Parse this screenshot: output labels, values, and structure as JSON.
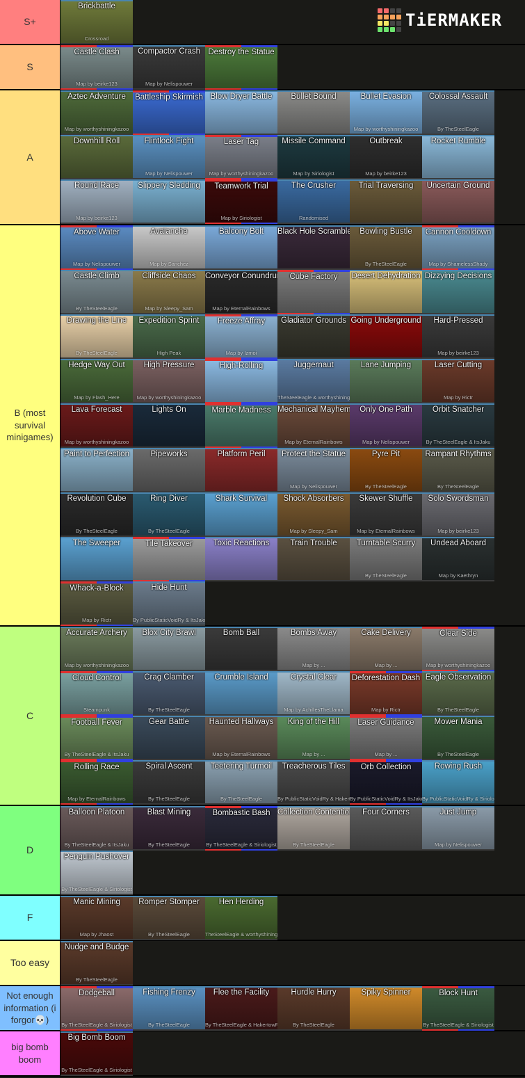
{
  "logo": {
    "text": "TiERMAKER",
    "grid_colors": [
      "#f46a6a",
      "#f46a6a",
      "#444",
      "#444",
      "#f7a35c",
      "#f7a35c",
      "#f7a35c",
      "#f7a35c",
      "#f5e663",
      "#f5e663",
      "#444",
      "#444",
      "#6de36d",
      "#6de36d",
      "#6de36d",
      "#444"
    ]
  },
  "tiers": [
    {
      "label": "S+",
      "color": "#ff7f7f",
      "items": [
        {
          "title": "Brickbattle",
          "sub": "Crossroad",
          "bg": "#6f7a3a"
        }
      ]
    },
    {
      "label": "S",
      "color": "#ffbf7f",
      "items": [
        {
          "title": "Castle Clash",
          "sub": "Map by beirke123",
          "bg": "#7a8a8a",
          "team": true
        },
        {
          "title": "Compactor Crash",
          "sub": "Map by Nelispouwer",
          "bg": "#3a3a3a"
        },
        {
          "title": "Destroy the Statue",
          "sub": "",
          "bg": "#4c7a3a",
          "team": true
        }
      ]
    },
    {
      "label": "A",
      "color": "#ffdf7f",
      "items": [
        {
          "title": "Aztec Adventure",
          "sub": "Map by worthyshiningkazoo",
          "bg": "#4e6a3a"
        },
        {
          "title": "Battleship Skirmish",
          "sub": "",
          "bg": "#3a6ad0",
          "team": true
        },
        {
          "title": "Blow Dryer Battle",
          "sub": "",
          "bg": "#8ab8e0"
        },
        {
          "title": "Bullet Bound",
          "sub": "",
          "bg": "#8a8a88"
        },
        {
          "title": "Bullet Evasion",
          "sub": "Map by worthyshiningkazoo",
          "bg": "#7ab0e0"
        },
        {
          "title": "Colossal Assault",
          "sub": "By TheSteelEagle",
          "bg": "#5a6e80"
        },
        {
          "title": "Downhill Roll",
          "sub": "",
          "bg": "#5a6a3a"
        },
        {
          "title": "Flintlock Fight",
          "sub": "Map by Nelispouwer",
          "bg": "#5a90c0"
        },
        {
          "title": "Laser Tag",
          "sub": "Map by worthyshiningkazoo",
          "bg": "#7a7e88",
          "team": true
        },
        {
          "title": "Missile Command",
          "sub": "Map by Siriologist",
          "bg": "#1e3a40"
        },
        {
          "title": "Outbreak",
          "sub": "Map by beirke123",
          "bg": "#2e2e2e"
        },
        {
          "title": "Rocket Rumble",
          "sub": "",
          "bg": "#8ab8d8"
        },
        {
          "title": "Round Race",
          "sub": "Map by beirke123",
          "bg": "#a0b0c0"
        },
        {
          "title": "Slippery Sledding",
          "sub": "",
          "bg": "#7ab0d0"
        },
        {
          "title": "Teamwork Trial",
          "sub": "Map by Siriologist",
          "bg": "#3a0a0a",
          "team": true
        },
        {
          "title": "The Crusher",
          "sub": "Randomised",
          "bg": "#3a6aa0"
        },
        {
          "title": "Trial Traversing",
          "sub": "",
          "bg": "#6a5a3a"
        },
        {
          "title": "Uncertain Ground",
          "sub": "",
          "bg": "#8a5a5a"
        }
      ]
    },
    {
      "label": "B (most survival minigames)",
      "color": "#ffff7f",
      "items": [
        {
          "title": "Above Water",
          "sub": "Map by Nelispouwer",
          "bg": "#5a8ac0",
          "team": true
        },
        {
          "title": "Avalanche",
          "sub": "Map by Sanchez",
          "bg": "#c8c8c8"
        },
        {
          "title": "Balcony Bolt",
          "sub": "",
          "bg": "#7aa8d8"
        },
        {
          "title": "Black Hole Scramble",
          "sub": "",
          "bg": "#3a2a3a"
        },
        {
          "title": "Bowling Bustle",
          "sub": "By TheSteelEagle",
          "bg": "#6a5a3a"
        },
        {
          "title": "Cannon Cooldown",
          "sub": "Map by ShamelessShady",
          "bg": "#7aa0c0",
          "team": true
        },
        {
          "title": "Castle Climb",
          "sub": "By TheSteelEagle",
          "bg": "#7a8a90"
        },
        {
          "title": "Cliffside Chaos",
          "sub": "Map by Sleepy_Sam",
          "bg": "#8a7a4a"
        },
        {
          "title": "Conveyor Conundrum",
          "sub": "Map by EternalRainbows",
          "bg": "#2a2a2a"
        },
        {
          "title": "Cube Factory",
          "sub": "",
          "bg": "#7a7a7a",
          "team": true
        },
        {
          "title": "Desert Dehydration",
          "sub": "",
          "bg": "#d8c07a"
        },
        {
          "title": "Dizzying Decisions",
          "sub": "",
          "bg": "#4a8a90"
        },
        {
          "title": "Drawing the Line",
          "sub": "By TheSteelEagle",
          "bg": "#e8d0a8"
        },
        {
          "title": "Expedition Sprint",
          "sub": "High Peak",
          "bg": "#4a6a4a"
        },
        {
          "title": "Freeze Affray",
          "sub": "Map by Izmoi",
          "bg": "#8ab0d0",
          "team": true
        },
        {
          "title": "Gladiator Grounds",
          "sub": "",
          "bg": "#3a3a30"
        },
        {
          "title": "Going Underground",
          "sub": "",
          "bg": "#8a0a0a"
        },
        {
          "title": "Hard-Pressed",
          "sub": "Map by beirke123",
          "bg": "#3a3a3a"
        },
        {
          "title": "Hedge Way Out",
          "sub": "Map by Flash_Here",
          "bg": "#4a6a3a"
        },
        {
          "title": "High Pressure",
          "sub": "Map by worthyshiningkazoo",
          "bg": "#7a6060"
        },
        {
          "title": "High-Rolling",
          "sub": "",
          "bg": "#8ab8e0",
          "team": true
        },
        {
          "title": "Juggernaut",
          "sub": "TheSteelEagle & worthyshiningkazoo",
          "bg": "#5a7aa0"
        },
        {
          "title": "Lane Jumping",
          "sub": "",
          "bg": "#5a7a5a"
        },
        {
          "title": "Laser Cutting",
          "sub": "Map by Rictr",
          "bg": "#6a3a2a"
        },
        {
          "title": "Lava Forecast",
          "sub": "Map by worthyshiningkazoo",
          "bg": "#6a1a1a"
        },
        {
          "title": "Lights On",
          "sub": "",
          "bg": "#1a2a3a"
        },
        {
          "title": "Marble Madness",
          "sub": "",
          "bg": "#4a7a6a",
          "team": true
        },
        {
          "title": "Mechanical Mayhem",
          "sub": "Map by EternalRainbows",
          "bg": "#6a4a3a"
        },
        {
          "title": "Only One Path",
          "sub": "Map by Nelispouwer",
          "bg": "#5a3a6a"
        },
        {
          "title": "Orbit Snatcher",
          "sub": "By TheSteelEagle & ItsJaku",
          "bg": "#2a3a40"
        },
        {
          "title": "Paint to Perfection",
          "sub": "",
          "bg": "#8ab0c8"
        },
        {
          "title": "Pipeworks",
          "sub": "",
          "bg": "#6a6a6a"
        },
        {
          "title": "Platform Peril",
          "sub": "",
          "bg": "#8a2a2a"
        },
        {
          "title": "Protect the Statue",
          "sub": "Map by Nelispouwer",
          "bg": "#7a8a9a"
        },
        {
          "title": "Pyre Pit",
          "sub": "By TheSteelEagle",
          "bg": "#8a4a10"
        },
        {
          "title": "Rampant Rhythms",
          "sub": "By TheSteelEagle",
          "bg": "#5a5a4a"
        },
        {
          "title": "Revolution Cube",
          "sub": "By TheSteelEagle",
          "bg": "#2a2a2a"
        },
        {
          "title": "Ring Diver",
          "sub": "By TheSteelEagle",
          "bg": "#2a5a70"
        },
        {
          "title": "Shark Survival",
          "sub": "",
          "bg": "#5aa0d0"
        },
        {
          "title": "Shock Absorbers",
          "sub": "Map by Sleepy_Sam",
          "bg": "#7a5a30"
        },
        {
          "title": "Skewer Shuffle",
          "sub": "Map by EternalRainbows",
          "bg": "#3a3a3a"
        },
        {
          "title": "Solo Swordsman",
          "sub": "Map by beirke123",
          "bg": "#6a6a70"
        },
        {
          "title": "The Sweeper",
          "sub": "",
          "bg": "#5aa0d0"
        },
        {
          "title": "Tile Takeover",
          "sub": "",
          "bg": "#9a9a9a",
          "team": true
        },
        {
          "title": "Toxic Reactions",
          "sub": "",
          "bg": "#8a80c8"
        },
        {
          "title": "Train Trouble",
          "sub": "",
          "bg": "#5a5040"
        },
        {
          "title": "Turntable Scurry",
          "sub": "By TheSteelEagle",
          "bg": "#7a7a7a"
        },
        {
          "title": "Undead Aboard",
          "sub": "Map by Kaethryn",
          "bg": "#2a3030"
        },
        {
          "title": "Whack-a-Block",
          "sub": "Map by Rictr",
          "bg": "#5a5a40",
          "team": true
        },
        {
          "title": "Hide Hunt",
          "sub": "By PublicStaticVoidRy & ItsJaku",
          "bg": "#6a7a8a"
        }
      ]
    },
    {
      "label": "C",
      "color": "#bfff7f",
      "items": [
        {
          "title": "Accurate Archery",
          "sub": "Map by worthyshiningkazoo",
          "bg": "#6a7a5a"
        },
        {
          "title": "Blox City Brawl",
          "sub": "",
          "bg": "#8a9aa0"
        },
        {
          "title": "Bomb Ball",
          "sub": "",
          "bg": "#3a3a3a"
        },
        {
          "title": "Bombs Away",
          "sub": "Map by ...",
          "bg": "#8a8a8a"
        },
        {
          "title": "Cake Delivery",
          "sub": "Map by ...",
          "bg": "#8a7a6a"
        },
        {
          "title": "Clear Side",
          "sub": "Map by worthyshiningkazoo",
          "bg": "#8a8a88",
          "team": true
        },
        {
          "title": "Cloud Control",
          "sub": "Steampunk",
          "bg": "#7aa0a0",
          "team": true
        },
        {
          "title": "Crag Clamber",
          "sub": "By TheSteelEagle",
          "bg": "#4a5a70"
        },
        {
          "title": "Crumble Island",
          "sub": "",
          "bg": "#5a9ac8"
        },
        {
          "title": "Crystal Clear",
          "sub": "Map by AchillesTheLlama",
          "bg": "#a0b8c8"
        },
        {
          "title": "Deforestation Dash",
          "sub": "Map by Rictr",
          "bg": "#7a3a2a",
          "team": true
        },
        {
          "title": "Eagle Observation",
          "sub": "By TheSteelEagle",
          "bg": "#5a6a4a"
        },
        {
          "title": "Football Fever",
          "sub": "By TheSteelEagle & ItsJaku",
          "bg": "#6a8a5a",
          "team": true
        },
        {
          "title": "Gear Battle",
          "sub": "",
          "bg": "#3a4a5a"
        },
        {
          "title": "Haunted Hallways",
          "sub": "Map by EternalRainbows",
          "bg": "#6a5a50"
        },
        {
          "title": "King of the Hill",
          "sub": "Map by ...",
          "bg": "#5a8a5a"
        },
        {
          "title": "Laser Guidance",
          "sub": "Map by ...",
          "bg": "#7a7a7a",
          "team": true
        },
        {
          "title": "Mower Mania",
          "sub": "By TheSteelEagle",
          "bg": "#3a5a3a"
        },
        {
          "title": "Rolling Race",
          "sub": "Map by EternalRainbows",
          "bg": "#3a5a30",
          "team": true
        },
        {
          "title": "Spiral Ascent",
          "sub": "By TheSteelEagle",
          "bg": "#3a3a3a"
        },
        {
          "title": "Teetering Turmoil",
          "sub": "By TheSteelEagle",
          "bg": "#8aa0b0"
        },
        {
          "title": "Treacherous Tiles",
          "sub": "By PublicStaticVoidRy & HakertowRBX",
          "bg": "#4a4a4a"
        },
        {
          "title": "Orb Collection",
          "sub": "By PublicStaticVoidRy & ItsJaku",
          "bg": "#1a1a2a",
          "team": true
        },
        {
          "title": "Rowing Rush",
          "sub": "By PublicStaticVoidRy & Siriologist",
          "bg": "#4aa0c8"
        }
      ]
    },
    {
      "label": "D",
      "color": "#7fff7f",
      "items": [
        {
          "title": "Balloon Platoon",
          "sub": "By TheSteelEagle & ItsJaku",
          "bg": "#6a5a5a"
        },
        {
          "title": "Blast Mining",
          "sub": "By TheSteelEagle",
          "bg": "#3a2a3a"
        },
        {
          "title": "Bombastic Bash",
          "sub": "By TheSteelEagle & Siriologist",
          "bg": "#2a2a3a",
          "team": true
        },
        {
          "title": "Collection Contention",
          "sub": "By TheSteelEagle",
          "bg": "#b0a8a0"
        },
        {
          "title": "Four Corners",
          "sub": "",
          "bg": "#5a5a5a"
        },
        {
          "title": "Just Jump",
          "sub": "Map by Nelispouwer",
          "bg": "#8a9aa8"
        },
        {
          "title": "Penguin Pushover",
          "sub": "By TheSteelEagle & Siriologist",
          "bg": "#c0c8d0"
        }
      ]
    },
    {
      "label": "F",
      "color": "#7fffff",
      "items": [
        {
          "title": "Manic Mining",
          "sub": "Map by Jhaost",
          "bg": "#5a3a2a"
        },
        {
          "title": "Romper Stomper",
          "sub": "By TheSteelEagle",
          "bg": "#5a4a3a"
        },
        {
          "title": "Hen Herding",
          "sub": "TheSteelEagle & worthyshiningkazoo",
          "bg": "#4a6a30"
        }
      ]
    },
    {
      "label": "Too easy",
      "color": "#ffff9f",
      "items": [
        {
          "title": "Nudge and Budge",
          "sub": "By TheSteelEagle",
          "bg": "#5a3a2a"
        }
      ]
    },
    {
      "label": "Not enough information (i forgor💀)",
      "color": "#7fbfff",
      "items": [
        {
          "title": "Dodgeball",
          "sub": "By TheSteelEagle & Siriologist",
          "bg": "#8a6a6a",
          "team": true
        },
        {
          "title": "Fishing Frenzy",
          "sub": "By TheSteelEagle",
          "bg": "#5a90c0"
        },
        {
          "title": "Flee the Facility",
          "sub": "By TheSteelEagle & HakertowRBX",
          "bg": "#4a1a1a"
        },
        {
          "title": "Hurdle Hurry",
          "sub": "By TheSteelEagle",
          "bg": "#5a3a2a"
        },
        {
          "title": "Spiky Spinner",
          "sub": "",
          "bg": "#d08a2a"
        },
        {
          "title": "Block Hunt",
          "sub": "By TheSteelEagle & Siriologist",
          "bg": "#3a5a40",
          "team": true
        }
      ]
    },
    {
      "label": "big bomb boom",
      "color": "#ff7fff",
      "items": [
        {
          "title": "Big Bomb Boom",
          "sub": "By TheSteelEagle & Siriologist",
          "bg": "#4a0a0a"
        }
      ]
    }
  ]
}
